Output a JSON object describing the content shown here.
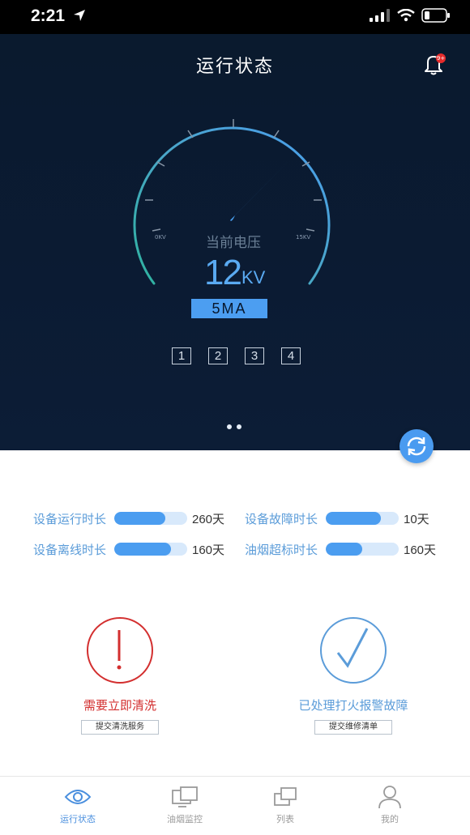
{
  "status_bar": {
    "time": "2:21"
  },
  "header": {
    "title": "运行状态",
    "badge": "9+"
  },
  "gauge": {
    "label": "当前电压",
    "value": "12",
    "unit": "KV",
    "min_label": "0KV",
    "max_label": "15KV",
    "current": "5MA",
    "needle_fraction": 0.8
  },
  "pager": {
    "pages": [
      "1",
      "2",
      "3",
      "4"
    ]
  },
  "stats": [
    {
      "label": "设备运行时长",
      "value": "260天",
      "fill": 0.7
    },
    {
      "label": "设备故障时长",
      "value": "10天",
      "fill": 0.75
    },
    {
      "label": "设备离线时长",
      "value": "160天",
      "fill": 0.78
    },
    {
      "label": "油烟超标时长",
      "value": "160天",
      "fill": 0.5
    }
  ],
  "alerts": {
    "left": {
      "symbol": "!",
      "text": "需要立即清洗",
      "button": "提交清洗服务",
      "color": "#d32f2f"
    },
    "right": {
      "symbol": "√",
      "text": "已处理打火报警故障",
      "button": "提交维修清单",
      "color": "#5b9cd9"
    }
  },
  "tabs": [
    {
      "label": "运行状态",
      "icon": "eye-icon",
      "active": true
    },
    {
      "label": "油烟监控",
      "icon": "monitor-icon",
      "active": false
    },
    {
      "label": "列表",
      "icon": "list-icon",
      "active": false
    },
    {
      "label": "我的",
      "icon": "person-icon",
      "active": false
    }
  ]
}
